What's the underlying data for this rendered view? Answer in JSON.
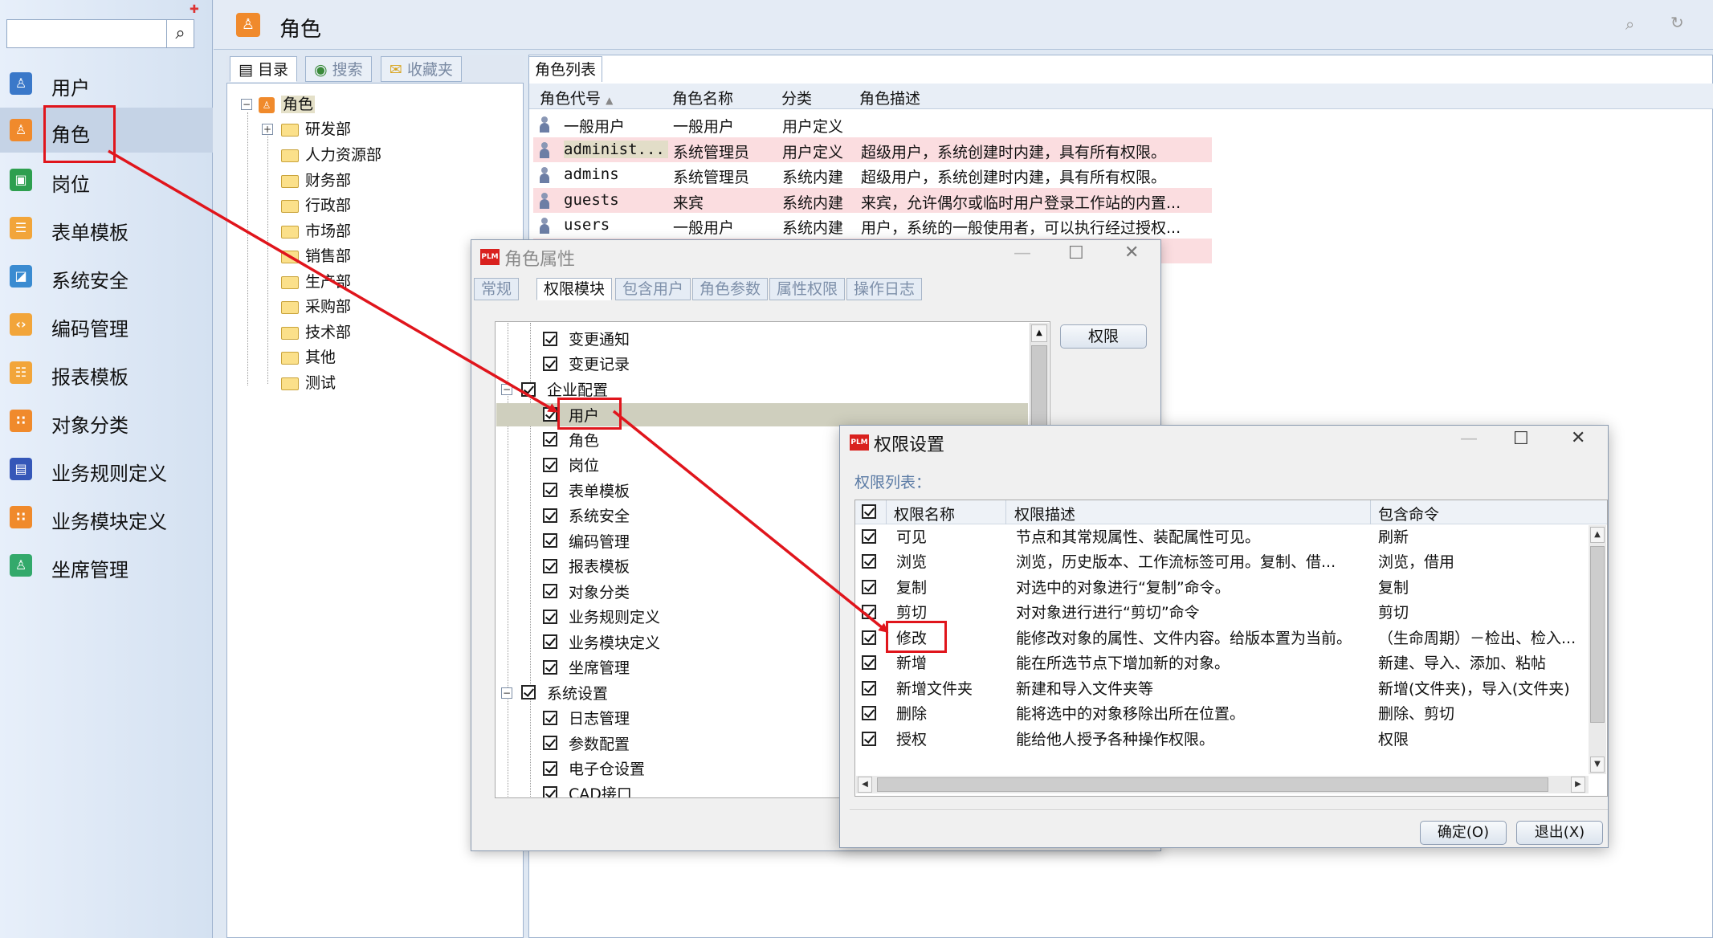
{
  "sidebar": {
    "search_placeholder": "",
    "items": [
      {
        "label": "用户",
        "color": "#3a78c9",
        "icon": "user-icon"
      },
      {
        "label": "角色",
        "color": "#f08a2c",
        "icon": "role-icon",
        "active": true
      },
      {
        "label": "岗位",
        "color": "#2e9f4f",
        "icon": "post-icon"
      },
      {
        "label": "表单模板",
        "color": "#f2a53a",
        "icon": "form-icon"
      },
      {
        "label": "系统安全",
        "color": "#3a8bd1",
        "icon": "security-icon"
      },
      {
        "label": "编码管理",
        "color": "#f2a53a",
        "icon": "code-icon"
      },
      {
        "label": "报表模板",
        "color": "#f2a53a",
        "icon": "report-icon"
      },
      {
        "label": "对象分类",
        "color": "#f08a2c",
        "icon": "category-icon"
      },
      {
        "label": "业务规则定义",
        "color": "#3557b8",
        "icon": "rule-icon"
      },
      {
        "label": "业务模块定义",
        "color": "#f08a2c",
        "icon": "module-icon"
      },
      {
        "label": "坐席管理",
        "color": "#33a96b",
        "icon": "seat-icon"
      }
    ]
  },
  "header": {
    "title": "角色"
  },
  "tree_tabs": [
    "目录",
    "搜索",
    "收藏夹"
  ],
  "tree": {
    "root": "角色",
    "children": [
      "研发部",
      "人力资源部",
      "财务部",
      "行政部",
      "市场部",
      "销售部",
      "生产部",
      "采购部",
      "技术部",
      "其他",
      "测试"
    ]
  },
  "role_list": {
    "tab": "角色列表",
    "columns": [
      "角色代号",
      "角色名称",
      "分类",
      "角色描述"
    ],
    "rows": [
      {
        "code": "一般用户",
        "name": "一般用户",
        "type": "用户定义",
        "desc": "",
        "highlight": false
      },
      {
        "code": "administ...",
        "name": "系统管理员",
        "type": "用户定义",
        "desc": "超级用户，系统创建时内建，具有所有权限。",
        "highlight": true
      },
      {
        "code": "admins",
        "name": "系统管理员",
        "type": "系统内建",
        "desc": "超级用户，系统创建时内建，具有所有权限。",
        "highlight": false
      },
      {
        "code": "guests",
        "name": "来宾",
        "type": "系统内建",
        "desc": "来宾，允许偶尔或临时用户登录工作站的内置...",
        "highlight": true
      },
      {
        "code": "users",
        "name": "一般用户",
        "type": "系统内建",
        "desc": "用户，系统的一般使用者，可以执行经过授权...",
        "highlight": false
      }
    ]
  },
  "role_window": {
    "title": "角色属性",
    "logo": "PLM",
    "tabs": [
      "常规",
      "权限模块",
      "包含用户",
      "角色参数",
      "属性权限",
      "操作日志"
    ],
    "perm_button": "权限",
    "tree_items": [
      {
        "label": "变更通知",
        "level": 2
      },
      {
        "label": "变更记录",
        "level": 2
      },
      {
        "label": "企业配置",
        "level": 1
      },
      {
        "label": "用户",
        "level": 2,
        "selected": true
      },
      {
        "label": "角色",
        "level": 2
      },
      {
        "label": "岗位",
        "level": 2
      },
      {
        "label": "表单模板",
        "level": 2
      },
      {
        "label": "系统安全",
        "level": 2
      },
      {
        "label": "编码管理",
        "level": 2
      },
      {
        "label": "报表模板",
        "level": 2
      },
      {
        "label": "对象分类",
        "level": 2
      },
      {
        "label": "业务规则定义",
        "level": 2
      },
      {
        "label": "业务模块定义",
        "level": 2
      },
      {
        "label": "坐席管理",
        "level": 2
      },
      {
        "label": "系统设置",
        "level": 1
      },
      {
        "label": "日志管理",
        "level": 2
      },
      {
        "label": "参数配置",
        "level": 2
      },
      {
        "label": "电子仓设置",
        "level": 2
      },
      {
        "label": "CAD接口",
        "level": 2
      }
    ]
  },
  "perm_window": {
    "title": "权限设置",
    "logo": "PLM",
    "list_label": "权限列表：",
    "columns": [
      "权限名称",
      "权限描述",
      "包含命令"
    ],
    "rows": [
      {
        "name": "可见",
        "desc": "节点和其常规属性、装配属性可见。",
        "cmds": "刷新"
      },
      {
        "name": "浏览",
        "desc": "浏览，历史版本、工作流标签可用。复制、借...",
        "cmds": "浏览，借用"
      },
      {
        "name": "复制",
        "desc": "对选中的对象进行“复制”命令。",
        "cmds": "复制"
      },
      {
        "name": "剪切",
        "desc": "对对象进行进行“剪切”命令",
        "cmds": "剪切"
      },
      {
        "name": "修改",
        "desc": "能修改对象的属性、文件内容。给版本置为当前。",
        "cmds": "（生命周期）－检出、检入..."
      },
      {
        "name": "新增",
        "desc": "能在所选节点下增加新的对象。",
        "cmds": "新建、导入、添加、粘帖"
      },
      {
        "name": "新增文件夹",
        "desc": "新建和导入文件夹等",
        "cmds": "新增(文件夹)，导入(文件夹)"
      },
      {
        "name": "删除",
        "desc": "能将选中的对象移除出所在位置。",
        "cmds": "删除、剪切"
      },
      {
        "name": "授权",
        "desc": "能给他人授予各种操作权限。",
        "cmds": "权限"
      }
    ],
    "ok_button": "确定(O)",
    "cancel_button": "退出(X)"
  },
  "colors": {
    "annotation": "#e0151c",
    "row_highlight": "#fbdde0",
    "selected_row": "#cfcfbe"
  }
}
